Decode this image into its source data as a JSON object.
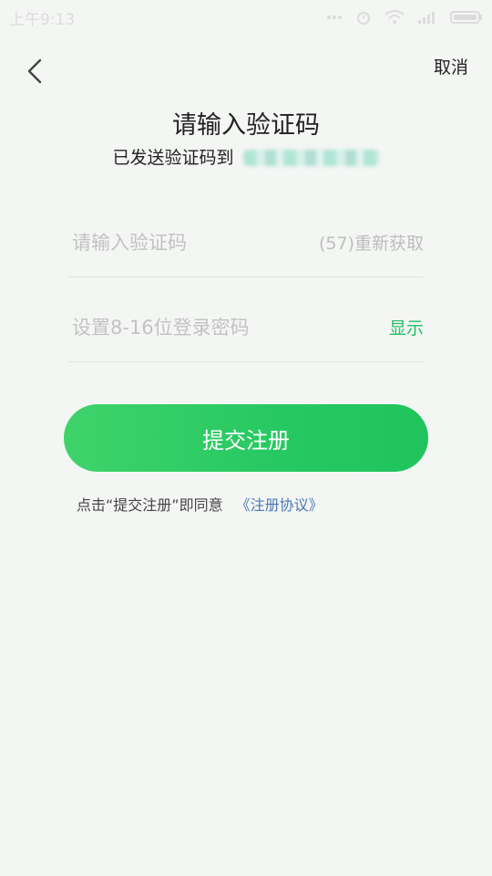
{
  "status_bar": {
    "time": "上午9:13",
    "icons": [
      "more-icon",
      "alarm-icon",
      "wifi-icon",
      "signal-icon",
      "battery-icon"
    ]
  },
  "nav": {
    "back_icon": "chevron-left-icon",
    "cancel_label": "取消"
  },
  "header": {
    "title": "请输入验证码",
    "subtitle_prefix": "已发送验证码到"
  },
  "form": {
    "code_placeholder": "请输入验证码",
    "resend_label": "(57)重新获取",
    "password_placeholder": "设置8-16位登录密码",
    "show_label": "显示"
  },
  "submit": {
    "label": "提交注册"
  },
  "agreement": {
    "text": "点击“提交注册”即同意",
    "link_label": "《注册协议》"
  },
  "colors": {
    "accent": "#22c35e",
    "link": "#4a78b3",
    "background": "#f4f6f4"
  }
}
